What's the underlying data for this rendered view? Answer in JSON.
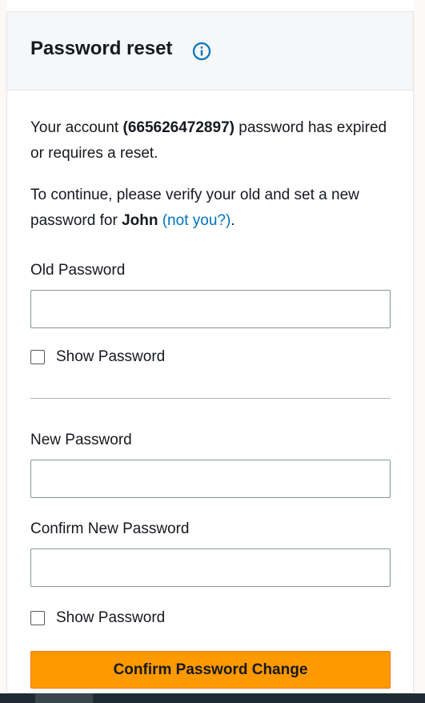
{
  "header": {
    "title": "Password reset",
    "info_icon": "info-icon"
  },
  "message": {
    "account_prefix": "Your account",
    "account_id": "(665626472897)",
    "account_suffix": "password has expired or requires a reset.",
    "continue_prefix": "To continue, please verify your old and set a new password for",
    "user": "John",
    "not_you": "(not you?)",
    "period": "."
  },
  "form": {
    "old_password_label": "Old Password",
    "old_password_value": "",
    "show_password_1": "Show Password",
    "new_password_label": "New Password",
    "new_password_value": "",
    "confirm_password_label": "Confirm New Password",
    "confirm_password_value": "",
    "show_password_2": "Show Password",
    "submit_label": "Confirm Password Change"
  },
  "colors": {
    "accent": "#ff9900",
    "link": "#0073bb"
  }
}
